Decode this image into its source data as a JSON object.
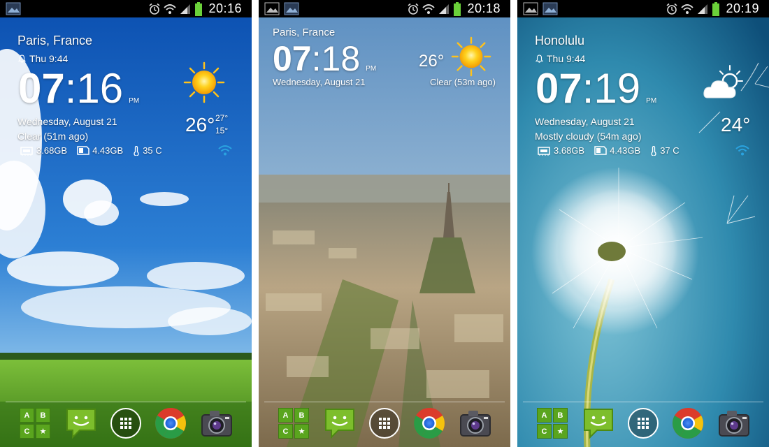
{
  "status_icons": [
    "image-icon",
    "screen-icon",
    "alarm-icon",
    "wifi-icon",
    "signal-icon",
    "battery-icon"
  ],
  "colors": {
    "statusbar": "#000000",
    "wifi_accent": "#2aa3e0",
    "battery": "#6bd13a",
    "dock_green": "#5aa51e"
  },
  "phones": [
    {
      "status_time": "20:16",
      "city": "Paris, France",
      "alarm": "Thu 9:44",
      "clock": {
        "hh": "07",
        "sep": ":",
        "mm": "16",
        "ampm": "PM"
      },
      "date": "Wednesday, August 21",
      "condition": "Clear (51m ago)",
      "temp": "26°",
      "high": "27°",
      "low": "15°",
      "weather_icon": "sun-icon",
      "stats": {
        "ram": "3.68GB",
        "storage": "4.43GB",
        "temp": "35 C"
      }
    },
    {
      "status_time": "20:18",
      "city": "Paris, France",
      "clock": {
        "hh": "07",
        "sep": ":",
        "mm": "18",
        "ampm": "PM"
      },
      "date": "Wednesday, August 21",
      "condition": "Clear (53m ago)",
      "temp": "26°",
      "weather_icon": "sun-icon"
    },
    {
      "status_time": "20:19",
      "city": "Honolulu",
      "alarm": "Thu 9:44",
      "clock": {
        "hh": "07",
        "sep": ":",
        "mm": "19",
        "ampm": "PM"
      },
      "date": "Wednesday, August 21",
      "condition": "Mostly cloudy (54m ago)",
      "temp": "24°",
      "weather_icon": "partly-cloudy-icon",
      "stats": {
        "ram": "3.68GB",
        "storage": "4.43GB",
        "temp": "37 C"
      }
    }
  ],
  "dock": {
    "apps_tile_letters": [
      "A",
      "B",
      "C",
      "★"
    ],
    "items": [
      "apps-tile-icon",
      "messaging-icon",
      "app-drawer-icon",
      "chrome-icon",
      "camera-icon"
    ]
  }
}
